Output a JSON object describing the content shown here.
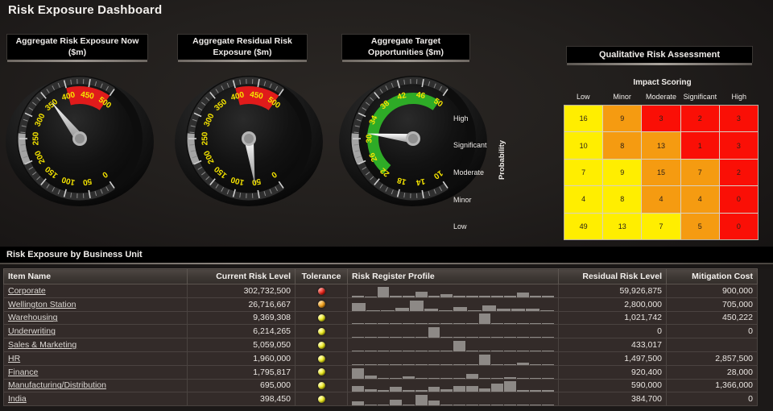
{
  "page_title": "Risk Exposure Dashboard",
  "kpi_plaques": [
    {
      "label": "Aggregate Risk Exposure Now ($m)"
    },
    {
      "label": "Aggregate Residual Risk Exposure ($m)"
    },
    {
      "label": "Aggregate Target Opportunities ($m)"
    }
  ],
  "gauges": [
    {
      "name": "aggregate-risk-exposure-now",
      "min": 0,
      "max": 500,
      "step": 50,
      "ticks": [
        "0",
        "50",
        "100",
        "150",
        "200",
        "250",
        "300",
        "350",
        "400",
        "450",
        "500"
      ],
      "value": 355,
      "band": {
        "from": 400,
        "to": 500,
        "color": "#e01b1b"
      },
      "scale_marker": {
        "from": 200,
        "to": 260
      }
    },
    {
      "name": "aggregate-residual-risk-exposure",
      "min": 0,
      "max": 500,
      "step": 50,
      "ticks": [
        "0",
        "50",
        "100",
        "150",
        "200",
        "250",
        "300",
        "350",
        "400",
        "450",
        "500"
      ],
      "value": 55,
      "band": {
        "from": 400,
        "to": 500,
        "color": "#e01b1b"
      },
      "scale_marker": {
        "from": 200,
        "to": 260
      }
    },
    {
      "name": "aggregate-target-opportunities",
      "min": 10,
      "max": 50,
      "step": 4,
      "ticks": [
        "10",
        "14",
        "18",
        "22",
        "26",
        "30",
        "34",
        "38",
        "42",
        "46",
        "50"
      ],
      "value": 31,
      "band": {
        "from": 22,
        "to": 50,
        "color": "#2eab27"
      },
      "scale_marker": {
        "from": 26,
        "to": 30.8
      }
    }
  ],
  "risk_matrix": {
    "title": "Qualitative Risk Assessment",
    "x_axis_label": "Impact Scoring",
    "y_axis_label": "Probability",
    "columns": [
      "Low",
      "Minor",
      "Moderate",
      "Significant",
      "High"
    ],
    "rows": [
      "High",
      "Significant",
      "Moderate",
      "Minor",
      "Low"
    ],
    "colors": {
      "yellow": "#ffee00",
      "orange": "#f59b11",
      "red": "#fa0f06"
    },
    "cells": [
      [
        {
          "value": "16",
          "color": "#ffee00"
        },
        {
          "value": "9",
          "color": "#f59b11"
        },
        {
          "value": "3",
          "color": "#fa0f06"
        },
        {
          "value": "2",
          "color": "#fa0f06"
        },
        {
          "value": "3",
          "color": "#fa0f06"
        }
      ],
      [
        {
          "value": "10",
          "color": "#ffee00"
        },
        {
          "value": "8",
          "color": "#f59b11"
        },
        {
          "value": "13",
          "color": "#f59b11"
        },
        {
          "value": "1",
          "color": "#fa0f06"
        },
        {
          "value": "3",
          "color": "#fa0f06"
        }
      ],
      [
        {
          "value": "7",
          "color": "#ffee00"
        },
        {
          "value": "9",
          "color": "#ffee00"
        },
        {
          "value": "15",
          "color": "#f59b11"
        },
        {
          "value": "7",
          "color": "#f59b11"
        },
        {
          "value": "2",
          "color": "#fa0f06"
        }
      ],
      [
        {
          "value": "4",
          "color": "#ffee00"
        },
        {
          "value": "8",
          "color": "#ffee00"
        },
        {
          "value": "4",
          "color": "#f59b11"
        },
        {
          "value": "4",
          "color": "#f59b11"
        },
        {
          "value": "0",
          "color": "#fa0f06"
        }
      ],
      [
        {
          "value": "49",
          "color": "#ffee00"
        },
        {
          "value": "13",
          "color": "#ffee00"
        },
        {
          "value": "7",
          "color": "#ffee00"
        },
        {
          "value": "5",
          "color": "#f59b11"
        },
        {
          "value": "0",
          "color": "#fa0f06"
        }
      ]
    ]
  },
  "section": {
    "title": "Risk Exposure by Business Unit"
  },
  "table": {
    "columns": [
      "Item Name",
      "Current Risk Level",
      "Tolerance",
      "Risk Register Profile",
      "Residual Risk Level",
      "Mitigation Cost"
    ],
    "rows": [
      {
        "name": "Corporate",
        "current_risk_level": "302,732,500",
        "tolerance": "red",
        "profile": [
          5,
          4,
          42,
          5,
          5,
          22,
          5,
          12,
          5,
          5,
          5,
          5,
          5,
          18,
          5,
          5
        ],
        "residual_risk_level": "59,926,875",
        "mitigation_cost": "900,000"
      },
      {
        "name": "Wellington Station",
        "current_risk_level": "26,716,667",
        "tolerance": "orange",
        "profile": [
          46,
          5,
          5,
          18,
          60,
          14,
          5,
          24,
          5,
          34,
          14,
          14,
          16,
          5
        ],
        "residual_risk_level": "2,800,000",
        "mitigation_cost": "705,000"
      },
      {
        "name": "Warehousing",
        "current_risk_level": "9,369,308",
        "tolerance": "yellow",
        "profile": [
          4,
          3,
          3,
          4,
          3,
          3,
          4,
          3,
          4,
          3,
          58,
          4,
          3,
          4,
          3,
          4
        ],
        "residual_risk_level": "1,021,742",
        "mitigation_cost": "450,222"
      },
      {
        "name": "Underwriting",
        "current_risk_level": "6,214,265",
        "tolerance": "yellow",
        "profile": [
          2,
          2,
          2,
          2,
          2,
          2,
          62,
          2,
          2,
          2,
          2,
          2,
          2,
          2,
          2,
          2
        ],
        "residual_risk_level": "0",
        "mitigation_cost": "0"
      },
      {
        "name": "Sales & Marketing",
        "current_risk_level": "5,059,050",
        "tolerance": "yellow",
        "profile": [
          3,
          3,
          3,
          3,
          3,
          3,
          3,
          3,
          70,
          3,
          3,
          3,
          3,
          3,
          3,
          3
        ],
        "residual_risk_level": "433,017",
        "mitigation_cost": ""
      },
      {
        "name": "HR",
        "current_risk_level": "1,960,000",
        "tolerance": "yellow",
        "profile": [
          2,
          2,
          2,
          2,
          2,
          2,
          2,
          2,
          2,
          2,
          64,
          2,
          2,
          14,
          2,
          2
        ],
        "residual_risk_level": "1,497,500",
        "mitigation_cost": "2,857,500"
      },
      {
        "name": "Finance",
        "current_risk_level": "1,795,817",
        "tolerance": "yellow",
        "profile": [
          50,
          16,
          4,
          4,
          10,
          4,
          4,
          4,
          4,
          22,
          4,
          4,
          8,
          4,
          4,
          4
        ],
        "residual_risk_level": "920,400",
        "mitigation_cost": "28,000"
      },
      {
        "name": "Manufacturing/Distribution",
        "current_risk_level": "695,000",
        "tolerance": "yellow",
        "profile": [
          26,
          10,
          6,
          22,
          8,
          6,
          22,
          10,
          26,
          28,
          14,
          40,
          52,
          6,
          6,
          6
        ],
        "residual_risk_level": "590,000",
        "mitigation_cost": "1,366,000"
      },
      {
        "name": "India",
        "current_risk_level": "398,450",
        "tolerance": "yellow",
        "profile": [
          28,
          8,
          8,
          40,
          8,
          70,
          34,
          8,
          8,
          8,
          8,
          8,
          8,
          8,
          8,
          8
        ],
        "residual_risk_level": "384,700",
        "mitigation_cost": "0"
      }
    ]
  }
}
